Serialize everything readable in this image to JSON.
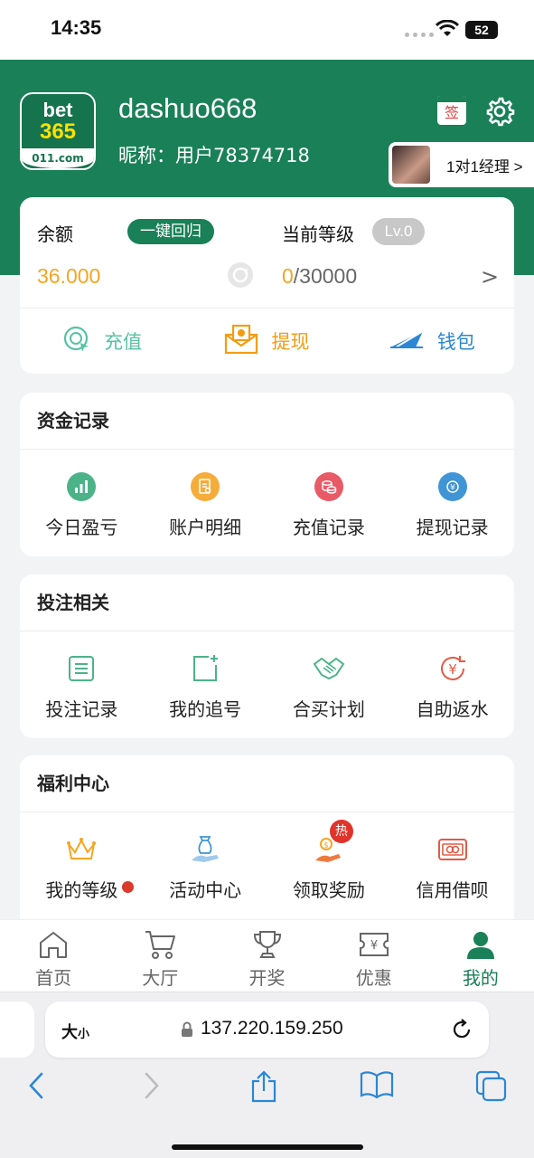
{
  "status_bar": {
    "time": "14:35",
    "battery": "52"
  },
  "header": {
    "logo": {
      "line1": "bet",
      "line2": "365",
      "line3": "011.com"
    },
    "username": "dashuo668",
    "nickname": "昵称：用户78374718",
    "sign_label": "签",
    "manager_label": "1对1经理 >"
  },
  "balance": {
    "label": "余额",
    "recall_label": "一键回归",
    "value": "36.000",
    "level_label": "当前等级",
    "level_badge": "Lv.0",
    "level_current": "0",
    "level_target": "/30000",
    "arrow": ">",
    "actions": {
      "recharge": "充值",
      "withdraw": "提现",
      "wallet": "钱包"
    }
  },
  "sections": {
    "funds": {
      "title": "资金记录",
      "items": [
        {
          "label": "今日盈亏",
          "icon": "profit-chart-icon"
        },
        {
          "label": "账户明细",
          "icon": "account-detail-icon"
        },
        {
          "label": "充值记录",
          "icon": "recharge-record-icon"
        },
        {
          "label": "提现记录",
          "icon": "withdraw-record-icon"
        }
      ]
    },
    "bets": {
      "title": "投注相关",
      "items": [
        {
          "label": "投注记录",
          "icon": "bet-list-icon"
        },
        {
          "label": "我的追号",
          "icon": "add-chase-icon"
        },
        {
          "label": "合买计划",
          "icon": "handshake-icon"
        },
        {
          "label": "自助返水",
          "icon": "yen-refund-icon"
        }
      ]
    },
    "welfare": {
      "title": "福利中心",
      "items": [
        {
          "label": "我的等级",
          "icon": "crown-icon"
        },
        {
          "label": "活动中心",
          "icon": "gift-hand-icon"
        },
        {
          "label": "领取奖励",
          "icon": "reward-hand-icon",
          "badge": "热"
        },
        {
          "label": "信用借呗",
          "icon": "credit-card-icon"
        }
      ]
    }
  },
  "tabbar": [
    {
      "label": "首页",
      "icon": "home-icon",
      "active": false
    },
    {
      "label": "大厅",
      "icon": "cart-icon",
      "active": false
    },
    {
      "label": "开奖",
      "icon": "trophy-icon",
      "active": false
    },
    {
      "label": "优惠",
      "icon": "coupon-icon",
      "active": false
    },
    {
      "label": "我的",
      "icon": "user-icon",
      "active": true
    }
  ],
  "browser": {
    "size_big": "大",
    "size_small": "小",
    "url": "137.220.159.250"
  },
  "colors": {
    "brand_green": "#1a8057",
    "accent_orange": "#f5a623",
    "recharge_teal": "#56c3a2",
    "wallet_blue": "#2b87d3",
    "dot_red": "#d93a2b"
  }
}
